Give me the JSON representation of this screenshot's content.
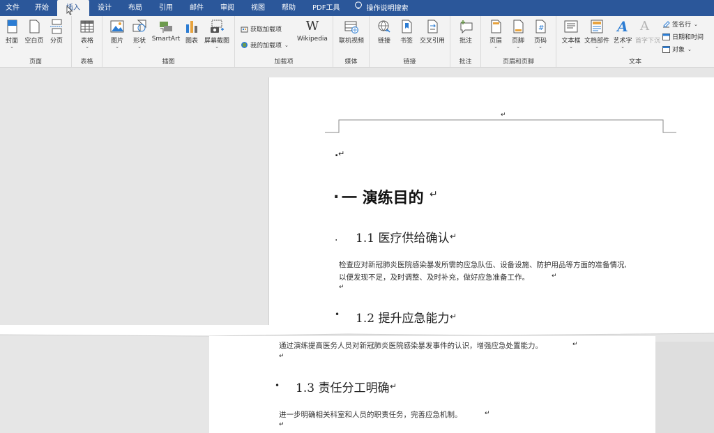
{
  "tabs": [
    {
      "label": "文件"
    },
    {
      "label": "开始"
    },
    {
      "label": "插入"
    },
    {
      "label": "设计"
    },
    {
      "label": "布局"
    },
    {
      "label": "引用"
    },
    {
      "label": "邮件"
    },
    {
      "label": "审阅"
    },
    {
      "label": "视图"
    },
    {
      "label": "帮助"
    },
    {
      "label": "PDF工具"
    },
    {
      "label": "操作说明搜索"
    }
  ],
  "ribbon": {
    "pages": {
      "cover": "封面",
      "blank": "空白页",
      "break": "分页",
      "group": "页面"
    },
    "tables": {
      "table": "表格",
      "group": "表格"
    },
    "illustrations": {
      "pictures": "图片",
      "shapes": "形状",
      "smartart": "SmartArt",
      "chart": "图表",
      "screenshot": "屏幕截图",
      "group": "插图"
    },
    "addins": {
      "get": "获取加载项",
      "my": "我的加载项",
      "wikipedia": "Wikipedia",
      "group": "加载项",
      "wiki_glyph": "W"
    },
    "media": {
      "video": "联机视频",
      "group": "媒体"
    },
    "links": {
      "link": "链接",
      "bookmark": "书签",
      "crossref": "交叉引用",
      "group": "链接"
    },
    "comments": {
      "comment": "批注",
      "group": "批注"
    },
    "headerfooter": {
      "header": "页眉",
      "footer": "页脚",
      "pagenum": "页码",
      "group": "页眉和页脚",
      "pagenum_glyph": "#"
    },
    "text": {
      "textbox": "文本框",
      "docparts": "文档部件",
      "wordart": "艺术字",
      "dropcap": "首字下沉",
      "signature": "签名行",
      "datetime": "日期和时间",
      "object": "对象",
      "group": "文本",
      "wordart_glyph": "A",
      "dropcap_glyph": "A"
    }
  },
  "document": {
    "para_mark": "↵",
    "heading1": "一 演练目的",
    "h2_1": "1.1 医疗供给确认",
    "body_1a": "检查应对新冠肺炎医院感染暴发所需的应急队伍、设备设施、防护用品等方面的准备情况,",
    "body_1b": "以便发现不足，及时调整、及时补充，做好应急准备工作。",
    "h2_2": "1.2 提升应急能力",
    "body_2": "通过演练提高医务人员对新冠肺炎医院感染暴发事件的认识，增强应急处置能力。",
    "h2_3": "1.3 责任分工明确",
    "body_3": "进一步明确相关科室和人员的职责任务，完善应急机制。",
    "bullet": "•",
    "dot": "."
  },
  "colors": {
    "accent": "#2b579a",
    "ribbon_bg": "#f3f3f3",
    "workspace": "#e6e6e6"
  }
}
